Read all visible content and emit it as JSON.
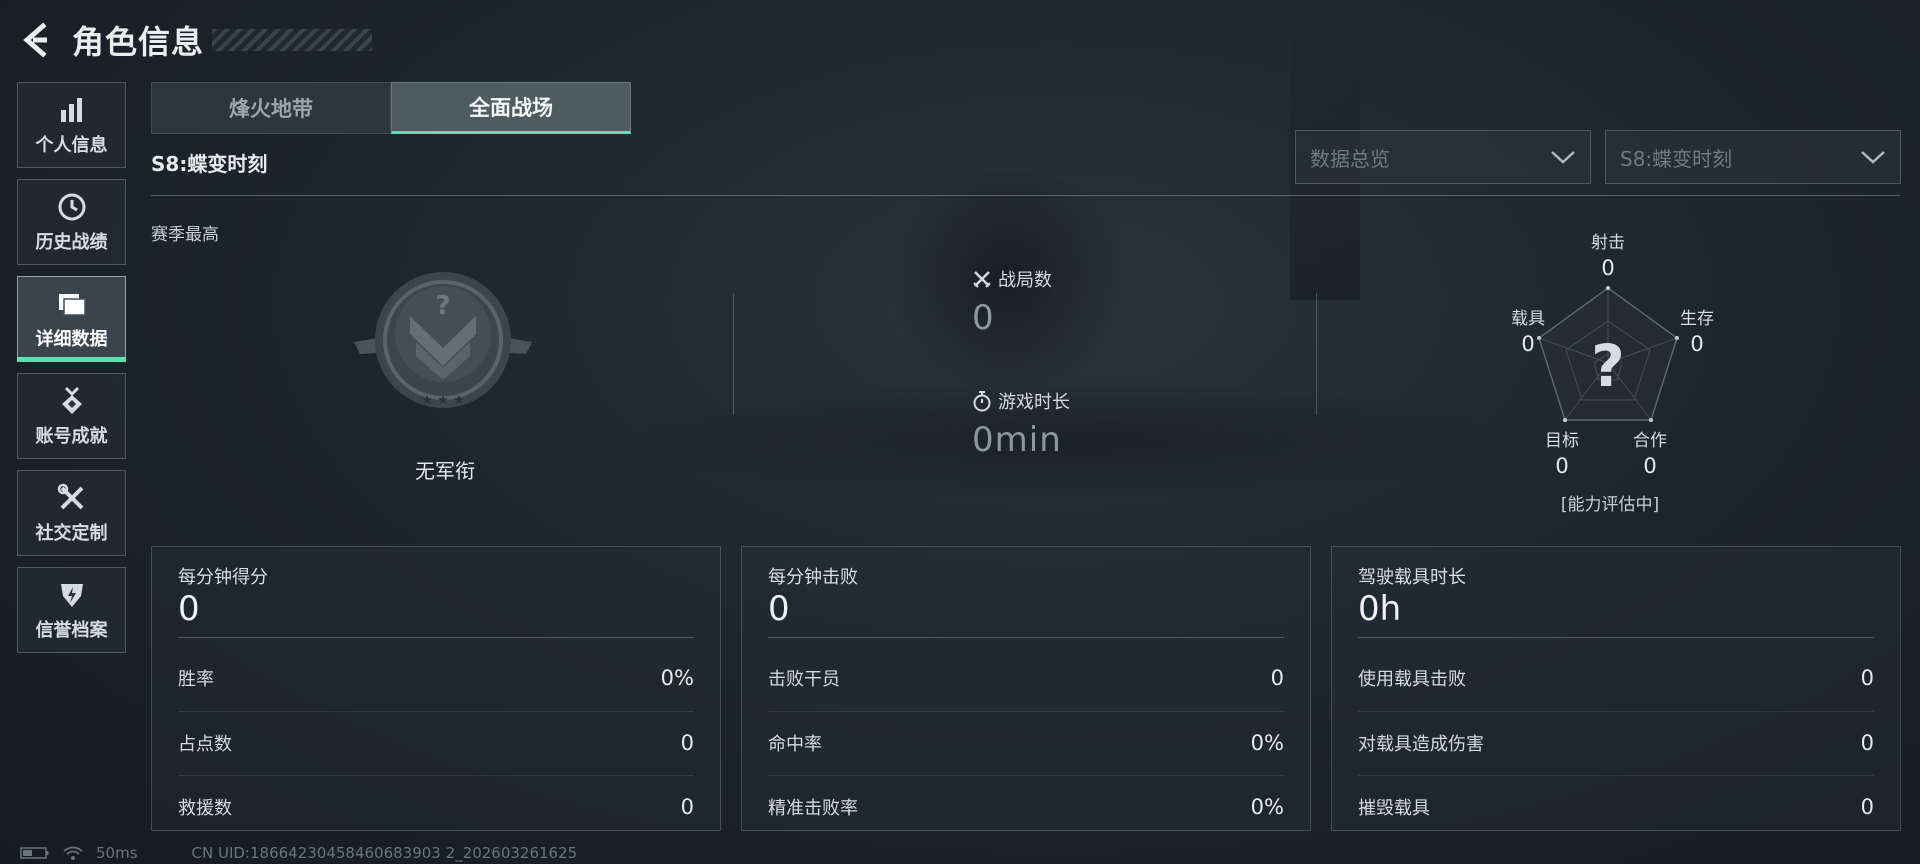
{
  "header": {
    "title": "角色信息"
  },
  "sidebar": {
    "items": [
      {
        "label": "个人信息",
        "icon": "bar-chart-icon"
      },
      {
        "label": "历史战绩",
        "icon": "history-clock-icon"
      },
      {
        "label": "详细数据",
        "icon": "folder-icon",
        "active": true
      },
      {
        "label": "账号成就",
        "icon": "medal-icon"
      },
      {
        "label": "社交定制",
        "icon": "tools-icon"
      },
      {
        "label": "信誉档案",
        "icon": "shield-lightning-icon"
      }
    ]
  },
  "mode_tabs": [
    {
      "label": "烽火地带",
      "active": false
    },
    {
      "label": "全面战场",
      "active": true
    }
  ],
  "season_title": "S8:蝶变时刻",
  "filters": {
    "overview": "数据总览",
    "season": "S8:蝶变时刻"
  },
  "season_best": {
    "label": "赛季最高",
    "rank_name": "无军衔"
  },
  "middle_stats": [
    {
      "label": "战局数",
      "value": "0",
      "icon": "crossed-swords-icon"
    },
    {
      "label": "游戏时长",
      "value": "0min",
      "icon": "stopwatch-icon"
    }
  ],
  "radar": {
    "axes": [
      {
        "label": "射击",
        "value": "0"
      },
      {
        "label": "生存",
        "value": "0"
      },
      {
        "label": "合作",
        "value": "0"
      },
      {
        "label": "目标",
        "value": "0"
      },
      {
        "label": "载具",
        "value": "0"
      }
    ],
    "center_mark": "?",
    "status": "[能力评估中]"
  },
  "cards": [
    {
      "title": "每分钟得分",
      "value": "0",
      "rows": [
        {
          "label": "胜率",
          "value": "0%"
        },
        {
          "label": "占点数",
          "value": "0"
        },
        {
          "label": "救援数",
          "value": "0"
        }
      ]
    },
    {
      "title": "每分钟击败",
      "value": "0",
      "rows": [
        {
          "label": "击败干员",
          "value": "0"
        },
        {
          "label": "命中率",
          "value": "0%"
        },
        {
          "label": "精准击败率",
          "value": "0%"
        }
      ]
    },
    {
      "title": "驾驶载具时长",
      "value": "0h",
      "rows": [
        {
          "label": "使用载具击败",
          "value": "0"
        },
        {
          "label": "对载具造成伤害",
          "value": "0"
        },
        {
          "label": "摧毁载具",
          "value": "0"
        }
      ]
    }
  ],
  "footer": {
    "ping": "50ms",
    "uid": "CN UID:18664230458460683903 2_202603261625"
  },
  "colors": {
    "accent": "#5fe0b4",
    "background": "#1d252d"
  }
}
